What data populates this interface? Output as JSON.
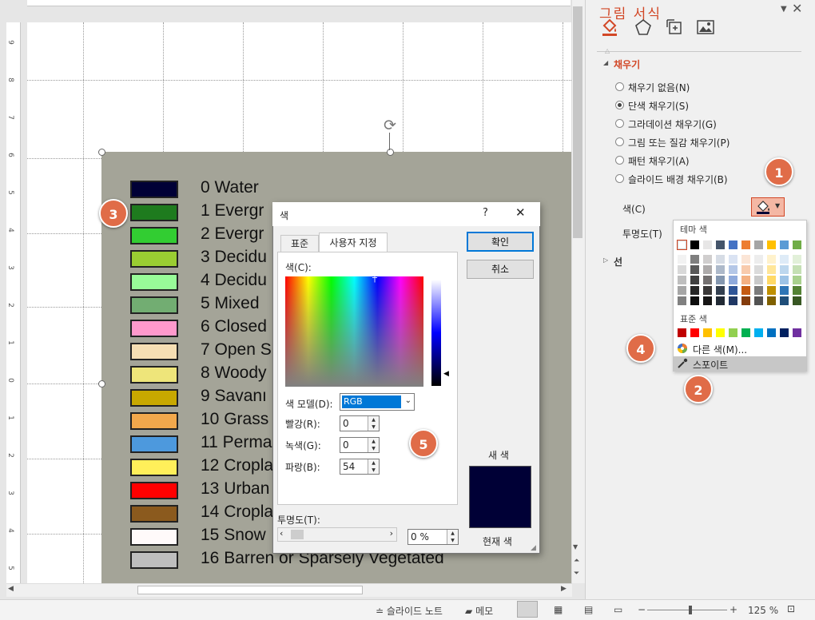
{
  "pane": {
    "title": "그림 서식",
    "section_fill": "채우기",
    "fill_options": [
      "채우기 없음(N)",
      "단색 채우기(S)",
      "그라데이션 채우기(G)",
      "그림 또는 질감 채우기(P)",
      "패턴 채우기(A)",
      "슬라이드 배경 채우기(B)"
    ],
    "selected_fill": "단색 채우기(S)",
    "color_label": "색(C)",
    "transparency_label": "투명도(T)",
    "line_section": "선"
  },
  "palette": {
    "theme_label": "테마 색",
    "standard_label": "표준 색",
    "more_colors": "다른 색(M)...",
    "eyedropper": "스포이트",
    "theme_top": [
      "#ffffff",
      "#000000",
      "#e7e6e6",
      "#44546a",
      "#4472c4",
      "#ed7d31",
      "#a5a5a5",
      "#ffc000",
      "#5b9bd5",
      "#70ad47"
    ],
    "theme_shades": [
      [
        "#f2f2f2",
        "#d9d9d9",
        "#bfbfbf",
        "#a6a6a6",
        "#808080"
      ],
      [
        "#7f7f7f",
        "#595959",
        "#404040",
        "#262626",
        "#0d0d0d"
      ],
      [
        "#d0cece",
        "#aeabab",
        "#757171",
        "#3a3838",
        "#171616"
      ],
      [
        "#d6dce5",
        "#adb9ca",
        "#8497b0",
        "#333f50",
        "#222a35"
      ],
      [
        "#dae3f3",
        "#b4c7e7",
        "#8faadc",
        "#2f5597",
        "#203864"
      ],
      [
        "#fbe5d6",
        "#f8cbad",
        "#f4b183",
        "#c55a11",
        "#843c0c"
      ],
      [
        "#ededed",
        "#dbdbdb",
        "#c9c9c9",
        "#7b7b7b",
        "#525252"
      ],
      [
        "#fff2cc",
        "#ffe699",
        "#ffd966",
        "#bf9000",
        "#7f6000"
      ],
      [
        "#deebf7",
        "#bdd7ee",
        "#9dc3e6",
        "#2e75b6",
        "#1f4e79"
      ],
      [
        "#e2f0d9",
        "#c5e0b4",
        "#a9d18e",
        "#548235",
        "#385723"
      ]
    ],
    "standard": [
      "#c00000",
      "#ff0000",
      "#ffc000",
      "#ffff00",
      "#92d050",
      "#00b050",
      "#00b0f0",
      "#0070c0",
      "#002060",
      "#7030a0"
    ]
  },
  "dialog": {
    "title": "색",
    "help": "?",
    "close": "✕",
    "tab_standard": "표준",
    "tab_custom": "사용자 지정",
    "ok": "확인",
    "cancel": "취소",
    "colors_label": "색(C):",
    "model_label": "색 모델(D):",
    "model_value": "RGB",
    "red_label": "빨강(R):",
    "red": "0",
    "green_label": "녹색(G):",
    "green": "0",
    "blue_label": "파랑(B):",
    "blue": "54",
    "transparency_label": "투명도(T):",
    "transparency": "0 %",
    "new_label": "새 색",
    "current_label": "현재 색",
    "new_color": "#000036"
  },
  "legend": [
    {
      "label": "0 Water",
      "color": "#000036"
    },
    {
      "label": "1 Evergr",
      "color": "#1e7b1e"
    },
    {
      "label": "2 Evergr",
      "color": "#32cd32"
    },
    {
      "label": "3 Decidu",
      "color": "#9acd32"
    },
    {
      "label": "4 Decidu",
      "color": "#98fb98"
    },
    {
      "label": "5 Mixed",
      "color": "#72ad72"
    },
    {
      "label": "6 Closed",
      "color": "#ff99cc"
    },
    {
      "label": "7 Open S",
      "color": "#f5deb3"
    },
    {
      "label": "8 Woody",
      "color": "#eee57a"
    },
    {
      "label": "9 Savanı",
      "color": "#c8a800"
    },
    {
      "label": "10 Grass",
      "color": "#f2a84c"
    },
    {
      "label": "11 Perma",
      "color": "#4d99dd"
    },
    {
      "label": "12 Cropla",
      "color": "#ffef5a"
    },
    {
      "label": "13 Urban",
      "color": "#ff0000"
    },
    {
      "label": "14 Cropla",
      "color": "#8b5a1e"
    },
    {
      "label": "15 Snow",
      "color": "#fffafa"
    },
    {
      "label": "16 Barren or Sparsely Vegetated",
      "color": "#bebebe"
    }
  ],
  "badges": [
    "1",
    "2",
    "3",
    "4",
    "5"
  ],
  "ruler_numbers": [
    "9",
    "8",
    "7",
    "6",
    "5",
    "4",
    "3",
    "2",
    "1",
    "0",
    "1",
    "2",
    "3",
    "4",
    "5"
  ],
  "status": {
    "notes": "슬라이드 노트",
    "comments": "메모",
    "zoom": "125 %"
  },
  "accent": "#d24726"
}
